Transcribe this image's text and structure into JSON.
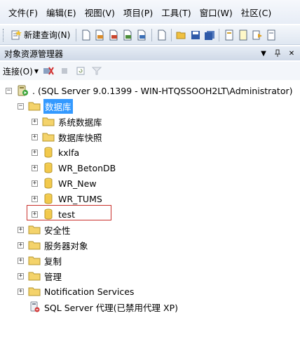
{
  "menubar": {
    "items": [
      "文件(F)",
      "编辑(E)",
      "视图(V)",
      "项目(P)",
      "工具(T)",
      "窗口(W)",
      "社区(C)"
    ]
  },
  "toolbar": {
    "new_query_label": "新建查询(N)"
  },
  "panel": {
    "title": "对象资源管理器",
    "connect_label": "连接(O)"
  },
  "tree": {
    "server": ". (SQL Server 9.0.1399 - WIN-HTQSSOOH2LT\\Administrator)",
    "databases": "数据库",
    "system_databases": "系统数据库",
    "db_snapshots": "数据库快照",
    "db1": "kxlfa",
    "db2": "WR_BetonDB",
    "db3": "WR_New",
    "db4": "WR_TUMS",
    "db5": "test",
    "security": "安全性",
    "server_objects": "服务器对象",
    "replication": "复制",
    "management": "管理",
    "notification": "Notification Services",
    "agent": "SQL Server 代理(已禁用代理 XP)"
  },
  "colors": {
    "selection": "#3399ff",
    "highlight_border": "#c9302c"
  }
}
